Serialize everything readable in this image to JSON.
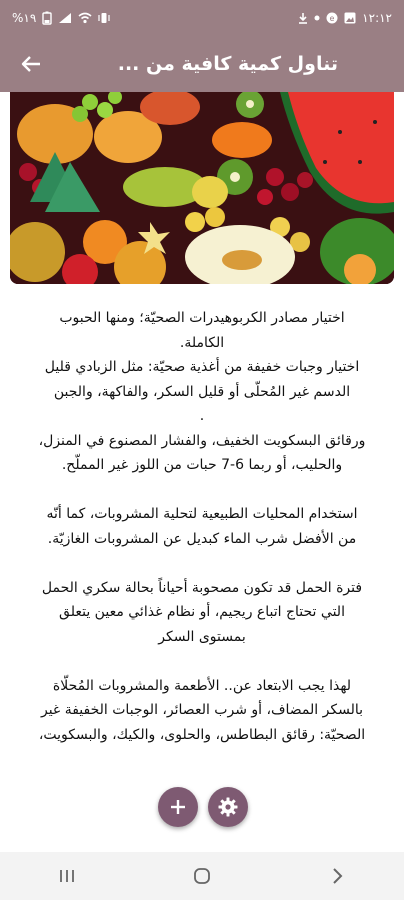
{
  "status_bar": {
    "battery_text": "%١٩",
    "time": "١٢:١٢"
  },
  "app_bar": {
    "title": "تناول كمية كافية من ..."
  },
  "article": {
    "lines": [
      "اختيار مصادر الكربوهيدرات الصحيّة؛ ومنها الحبوب",
      "الكاملة.",
      "اختيار وجبات خفيفة من أغذية صحيّة: مثل الزبادي قليل",
      "الدسم غير المُحلّى أو قليل السكر، والفاكهة، والجبن",
      ".",
      "ورقائق البسكويت الخفيف، والفشار المصنوع في المنزل،",
      "والحليب، أو ربما 6-7 حبات من اللوز غير المملّح.",
      "",
      "استخدام المحليات الطبيعية لتحلية المشروبات، كما أنّه",
      "من الأفضل شرب الماء كبديل عن المشروبات الغازيّة.",
      "",
      "فترة الحمل قد تكون مصحوبة أحياناً بحالة سكري الحمل",
      "التي تحتاج اتباع ريجيم، أو نظام غذائي معين يتعلق",
      "بمستوى السكر",
      "",
      "لهذا يجب الابتعاد عن.. الأطعمة والمشروبات المُحلّاة",
      "بالسكر المضاف، أو شرب العصائر، الوجبات الخفيفة غير",
      "الصحيّة: رقائق البطاطس، والحلوى، والكيك، والبسكويت،"
    ]
  },
  "icons": {
    "back": "arrow-back-icon",
    "add": "plus-icon",
    "settings": "gear-icon",
    "nav_recents": "recents-icon",
    "nav_home": "home-icon",
    "nav_back": "chevron-back-icon"
  },
  "colors": {
    "app_bar": "#9a7f84",
    "fab": "#7e5a72",
    "nav_bar": "#f3f3f3"
  }
}
